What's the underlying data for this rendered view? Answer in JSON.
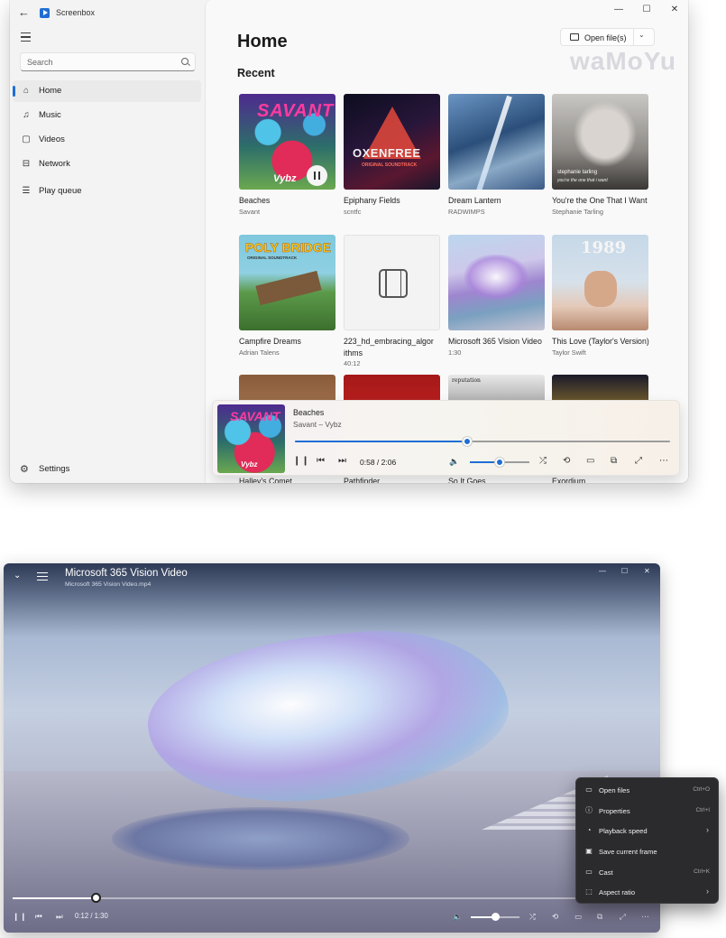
{
  "app": {
    "name": "Screenbox"
  },
  "sidebar": {
    "search_placeholder": "Search",
    "items": [
      {
        "label": "Home",
        "icon": "home-icon",
        "active": true
      },
      {
        "label": "Music",
        "icon": "music-note-icon"
      },
      {
        "label": "Videos",
        "icon": "video-icon"
      },
      {
        "label": "Network",
        "icon": "network-icon"
      },
      {
        "label": "Play queue",
        "icon": "play-queue-icon"
      }
    ],
    "settings_label": "Settings"
  },
  "main": {
    "title": "Home",
    "section_title": "Recent",
    "open_files_label": "Open file(s)",
    "watermark": "waMoYu"
  },
  "recent": [
    {
      "title": "Beaches",
      "subtitle": "Savant"
    },
    {
      "title": "Epiphany Fields",
      "subtitle": "scntfc"
    },
    {
      "title": "Dream Lantern",
      "subtitle": "RADWIMPS"
    },
    {
      "title": "You're the One That I Want",
      "subtitle": "Stephanie Tarling"
    },
    {
      "title": "Campfire Dreams",
      "subtitle": "Adrian Talens"
    },
    {
      "title": "223_hd_embracing_algorithms",
      "subtitle": "40:12"
    },
    {
      "title": "Microsoft 365 Vision Video",
      "subtitle": "1:30"
    },
    {
      "title": "This Love (Taylor's Version)",
      "subtitle": "Taylor Swift"
    },
    {
      "title": "Halley's Comet",
      "subtitle": ""
    },
    {
      "title": "Pathfinder",
      "subtitle": ""
    },
    {
      "title": "So It Goes...",
      "subtitle": ""
    },
    {
      "title": "Exordium",
      "subtitle": ""
    }
  ],
  "art_text": {
    "savant": "SAVANT",
    "vybz": "Vybz",
    "oxenfree": "OXENFREE",
    "oxen_sub": "ORIGINAL SOUNDTRACK",
    "poly": "POLY BRIDGE",
    "poly_sub": "ORIGINAL SOUNDTRACK",
    "stephanie": "stephanie tarling",
    "stephanie_sub": "you're the one that i want",
    "t1989": "1989",
    "reputation": "reputation"
  },
  "player": {
    "title": "Beaches",
    "subtitle": "Savant – Vybz",
    "time": "0:58 / 2:06",
    "progress": 0.46,
    "volume": 0.5
  },
  "video": {
    "title": "Microsoft 365 Vision Video",
    "filename": "Microsoft 365 Vision Video.mp4",
    "time": "0:12 / 1:30",
    "progress": 0.13,
    "volume": 0.5
  },
  "context_menu": [
    {
      "label": "Open files",
      "accel": "Ctrl+O",
      "icon": "folder-icon"
    },
    {
      "label": "Properties",
      "accel": "Ctrl+I",
      "icon": "info-icon"
    },
    {
      "label": "Playback speed",
      "accel": "",
      "icon": "speedometer-icon",
      "submenu": true
    },
    {
      "label": "Save current frame",
      "accel": "",
      "icon": "save-frame-icon"
    },
    {
      "label": "Cast",
      "accel": "Ctrl+K",
      "icon": "cast-icon"
    },
    {
      "label": "Aspect ratio",
      "accel": "",
      "icon": "aspect-ratio-icon",
      "submenu": true
    }
  ],
  "colors": {
    "accent": "#1f6ed4",
    "menu_bg": "#2b2b2e"
  }
}
